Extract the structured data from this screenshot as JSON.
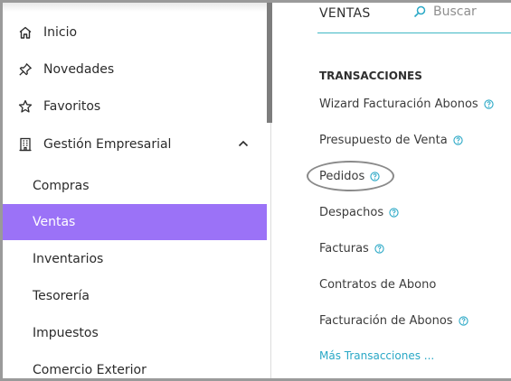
{
  "sidebar": {
    "items": [
      {
        "label": "Inicio",
        "icon": "home-icon"
      },
      {
        "label": "Novedades",
        "icon": "pin-icon"
      },
      {
        "label": "Favoritos",
        "icon": "star-icon"
      },
      {
        "label": "Gestión Empresarial",
        "icon": "building-icon",
        "expanded": true
      }
    ],
    "subitems": [
      "Compras",
      "Ventas",
      "Inventarios",
      "Tesorería",
      "Impuestos",
      "Comercio Exterior"
    ],
    "active_subitem": "Ventas",
    "accent_color": "#9b72f7"
  },
  "panel": {
    "tab_label": "VENTAS",
    "search_placeholder": "Buscar",
    "section_title": "TRANSACCIONES",
    "links": [
      {
        "label": "Wizard Facturación Abonos",
        "help": true
      },
      {
        "label": "Presupuesto de Venta",
        "help": true
      },
      {
        "label": "Pedidos",
        "help": true,
        "highlighted": true
      },
      {
        "label": "Despachos",
        "help": true
      },
      {
        "label": "Facturas",
        "help": true
      },
      {
        "label": "Contratos de Abono",
        "help": false
      },
      {
        "label": "Facturación de Abonos",
        "help": true
      }
    ],
    "more_link": "Más Transacciones ...",
    "link_color": "#2aa8c6"
  }
}
